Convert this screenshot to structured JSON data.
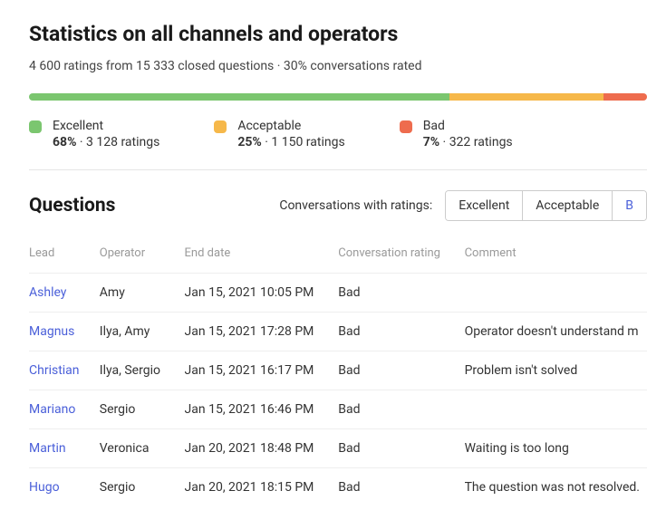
{
  "header": {
    "title": "Statistics on all channels and operators",
    "ratings_count": "4 600",
    "closed_questions": "15 333",
    "percent_rated": "30%",
    "summary_template_1": " ratings from ",
    "summary_template_2": " closed questions  ·  ",
    "summary_template_3": " conversations rated"
  },
  "legend": {
    "excellent": {
      "label": "Excellent",
      "pct": "68%",
      "count": "3 128 ratings",
      "sep": " · "
    },
    "acceptable": {
      "label": "Acceptable",
      "pct": "25%",
      "count": "1 150 ratings",
      "sep": " · "
    },
    "bad": {
      "label": "Bad",
      "pct": "7%",
      "count": "322 ratings",
      "sep": " · "
    }
  },
  "questions": {
    "title": "Questions",
    "filter_label": "Conversations with ratings:",
    "filter_options": {
      "excellent": "Excellent",
      "acceptable": "Acceptable",
      "bad": "B"
    }
  },
  "table": {
    "headers": {
      "lead": "Lead",
      "operator": "Operator",
      "end_date": "End date",
      "rating": "Conversation rating",
      "comment": "Comment"
    },
    "rows": [
      {
        "lead": "Ashley",
        "operator": "Amy",
        "end_date": "Jan 15, 2021 10:05 PM",
        "rating": "Bad",
        "comment": ""
      },
      {
        "lead": "Magnus",
        "operator": "Ilya, Amy",
        "end_date": "Jan 15, 2021 17:28 PM",
        "rating": "Bad",
        "comment": "Operator doesn't understand m"
      },
      {
        "lead": "Christian",
        "operator": "Ilya, Sergio",
        "end_date": "Jan 15, 2021 16:17 PM",
        "rating": "Bad",
        "comment": "Problem isn't solved"
      },
      {
        "lead": "Mariano",
        "operator": "Sergio",
        "end_date": "Jan 15, 2021 16:46 PM",
        "rating": "Bad",
        "comment": ""
      },
      {
        "lead": "Martin",
        "operator": "Veronica",
        "end_date": "Jan 20, 2021 18:48 PM",
        "rating": "Bad",
        "comment": "Waiting is too long"
      },
      {
        "lead": "Hugo",
        "operator": "Sergio",
        "end_date": "Jan 20, 2021 18:15 PM",
        "rating": "Bad",
        "comment": "The question was not resolved."
      }
    ]
  }
}
